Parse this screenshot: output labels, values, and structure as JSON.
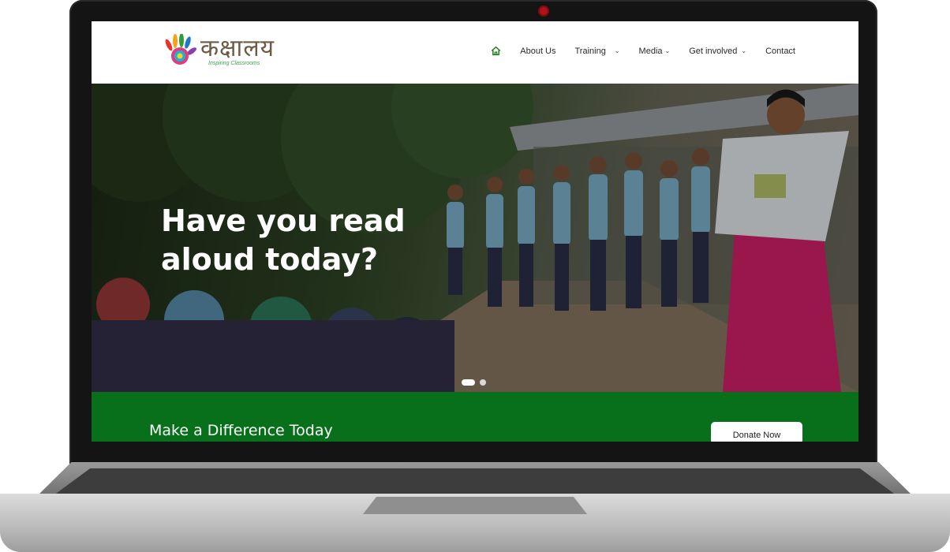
{
  "site": {
    "logo_text": "कक्षालय",
    "logo_tagline": "Inspiring Classrooms",
    "nav": {
      "home_icon": "home-icon",
      "items": [
        {
          "label": "About Us",
          "has_dropdown": false
        },
        {
          "label": "Training",
          "has_dropdown": true
        },
        {
          "label": "Media",
          "has_dropdown": true
        },
        {
          "label": "Get involved",
          "has_dropdown": true
        },
        {
          "label": "Contact",
          "has_dropdown": false
        }
      ]
    }
  },
  "hero": {
    "title_line1": "Have you read",
    "title_line2": "aloud today?",
    "slides_total": 2,
    "active_slide": 1
  },
  "cta": {
    "title": "Make a Difference Today",
    "button_label": "Donate Now"
  },
  "colors": {
    "brand_green": "#08701a",
    "home_icon": "#1a7a1a",
    "camera": "#b0141a"
  }
}
